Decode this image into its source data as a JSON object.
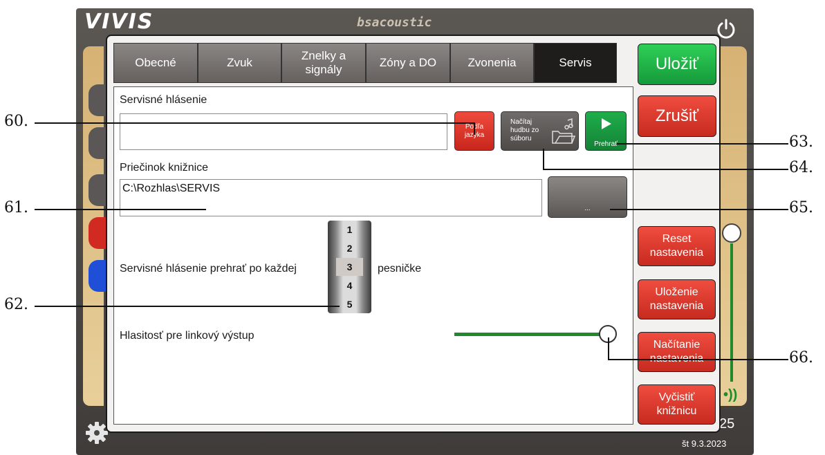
{
  "app": {
    "brand": "VIVIS",
    "brand_secondary": "bsacoustic"
  },
  "tabs": [
    {
      "label": "Obecné",
      "active": false
    },
    {
      "label": "Zvuk",
      "active": false
    },
    {
      "label": "Znelky a\nsignály",
      "active": false
    },
    {
      "label": "Zóny a DO",
      "active": false
    },
    {
      "label": "Zvonenia",
      "active": false
    },
    {
      "label": "Servis",
      "active": true
    }
  ],
  "service": {
    "announcement_label": "Servisné hlásenie",
    "announcement_value": "",
    "lang_button": "Podľa\njazyka",
    "load_music_button": "Načítaj\nhudbu zo\nsúboru",
    "play_button": "Prehrať",
    "folder_label": "Priečinok knižnice",
    "folder_value": "C:\\Rozhlas\\SERVIS",
    "browse_button": "...",
    "repeat_label_before": "Servisné hlásenie prehrať po každej",
    "repeat_label_after": "pesničke",
    "picker_values": [
      "1",
      "2",
      "3",
      "4",
      "5"
    ],
    "picker_selected": "3",
    "line_volume_label": "Hlasitosť pre linkový výstup",
    "line_volume_level": 1.0
  },
  "actions": {
    "save": "Uložiť",
    "cancel": "Zrušiť",
    "reset": "Reset\nnastavenia",
    "store": "Uloženie\nnastavenia",
    "loadsettings": "Načítanie\nnastavenia",
    "clear": "Vyčistiť\nknižnicu"
  },
  "status": {
    "time": "25",
    "date": "št 9.3.2023"
  },
  "callouts": [
    "60.",
    "61.",
    "62.",
    "63.",
    "64.",
    "65.",
    "66."
  ],
  "colors": {
    "green": "#1e8a2c",
    "red": "#d9342a",
    "dark_tab": "#1f1d1c"
  }
}
